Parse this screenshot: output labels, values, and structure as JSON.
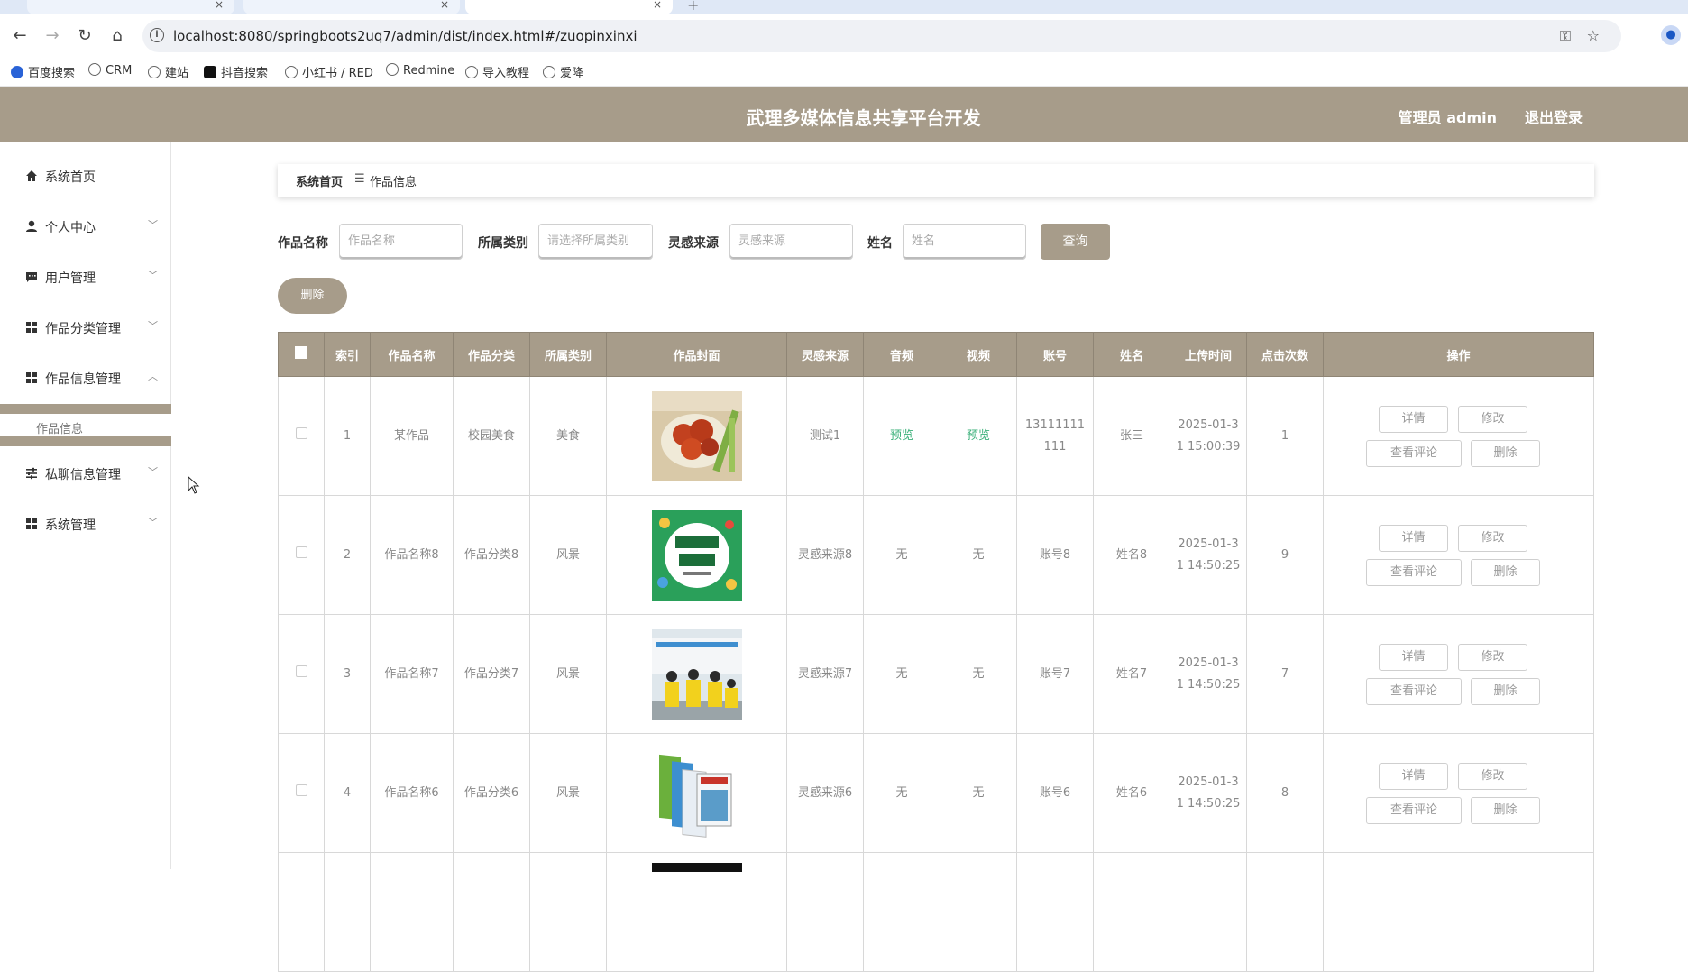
{
  "browser": {
    "url": "localhost:8080/springboots2uq7/admin/dist/index.html#/zuopinxinxi",
    "bookmarks": [
      "百度搜索",
      "CRM",
      "建站",
      "抖音搜索",
      "小红书 / RED",
      "Redmine",
      "导入教程",
      "爱降"
    ]
  },
  "header": {
    "title": "武理多媒体信息共享平台开发",
    "user": "管理员 admin",
    "logout": "退出登录"
  },
  "sidebar": {
    "items": [
      {
        "label": "系统首页",
        "icon": "home-icon"
      },
      {
        "label": "个人中心",
        "icon": "user-icon"
      },
      {
        "label": "用户管理",
        "icon": "chat-icon"
      },
      {
        "label": "作品分类管理",
        "icon": "grid-icon"
      },
      {
        "label": "作品信息管理",
        "icon": "grid-icon"
      },
      {
        "label": "私聊信息管理",
        "icon": "sliders-icon"
      },
      {
        "label": "系统管理",
        "icon": "grid-icon"
      }
    ],
    "subitem": "作品信息"
  },
  "breadcrumb": {
    "home": "系统首页",
    "current": "作品信息"
  },
  "search": {
    "name_label": "作品名称",
    "name_placeholder": "作品名称",
    "category_label": "所属类别",
    "category_placeholder": "请选择所属类别",
    "source_label": "灵感来源",
    "source_placeholder": "灵感来源",
    "person_label": "姓名",
    "person_placeholder": "姓名",
    "query": "查询",
    "delete": "删除"
  },
  "table": {
    "headers": [
      "索引",
      "作品名称",
      "作品分类",
      "所属类别",
      "作品封面",
      "灵感来源",
      "音频",
      "视频",
      "账号",
      "姓名",
      "上传时间",
      "点击次数",
      "操作"
    ],
    "actions": [
      "详情",
      "修改",
      "查看评论",
      "删除"
    ],
    "rows": [
      {
        "index": "1",
        "name": "某作品",
        "cls": "校园美食",
        "cat": "美食",
        "source": "测试1",
        "audio": "预览",
        "video": "预览",
        "account": "13111111111",
        "person": "张三",
        "time": "2025-01-31 15:00:39",
        "clicks": "1"
      },
      {
        "index": "2",
        "name": "作品名称8",
        "cls": "作品分类8",
        "cat": "风景",
        "source": "灵感来源8",
        "audio": "无",
        "video": "无",
        "account": "账号8",
        "person": "姓名8",
        "time": "2025-01-31 14:50:25",
        "clicks": "9"
      },
      {
        "index": "3",
        "name": "作品名称7",
        "cls": "作品分类7",
        "cat": "风景",
        "source": "灵感来源7",
        "audio": "无",
        "video": "无",
        "account": "账号7",
        "person": "姓名7",
        "time": "2025-01-31 14:50:25",
        "clicks": "7"
      },
      {
        "index": "4",
        "name": "作品名称6",
        "cls": "作品分类6",
        "cat": "风景",
        "source": "灵感来源6",
        "audio": "无",
        "video": "无",
        "account": "账号6",
        "person": "姓名6",
        "time": "2025-01-31 14:50:25",
        "clicks": "8"
      }
    ]
  },
  "colors": {
    "accent": "#a79c8a",
    "preview": "#3bb07a"
  }
}
